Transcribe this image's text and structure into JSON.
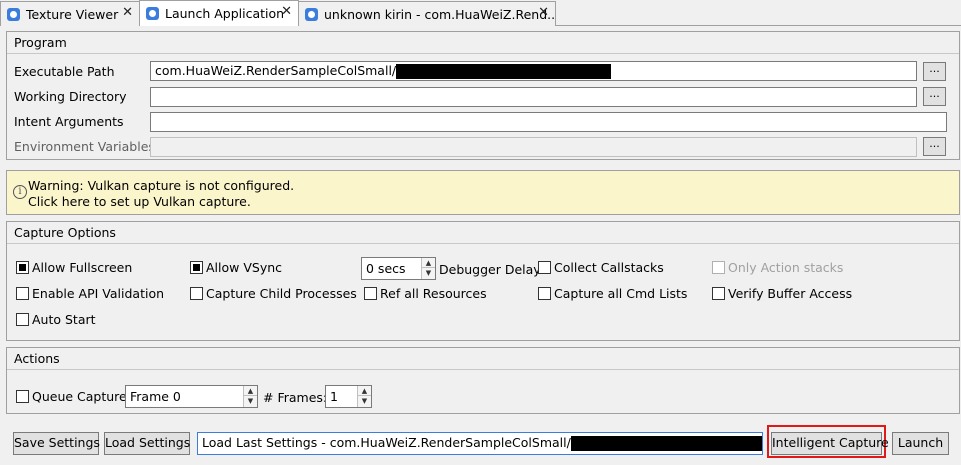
{
  "tabs": [
    {
      "label": "Texture Viewer",
      "close": "✕"
    },
    {
      "label": "Launch Application",
      "close": "✕"
    },
    {
      "label": "unknown kirin - com.HuaWeiZ.Rend...",
      "close": "✕"
    }
  ],
  "program": {
    "title": "Program",
    "executable_path_label": "Executable Path",
    "executable_path_value": "com.HuaWeiZ.RenderSampleColSmall/",
    "working_directory_label": "Working Directory",
    "working_directory_value": "",
    "intent_arguments_label": "Intent Arguments",
    "intent_arguments_value": "",
    "environment_variables_label": "Environment Variables",
    "environment_variables_value": "",
    "browse_label": "..."
  },
  "warning": {
    "icon": "info-icon",
    "line1": "Warning: Vulkan capture is not configured.",
    "line2": "Click here to set up Vulkan capture."
  },
  "capture_options": {
    "title": "Capture Options",
    "allow_fullscreen": "Allow Fullscreen",
    "allow_vsync": "Allow VSync",
    "debugger_delay_value": "0 secs",
    "debugger_delay_label": "Debugger Delay",
    "collect_callstacks": "Collect Callstacks",
    "only_action_stacks": "Only Action stacks",
    "enable_api_validation": "Enable API Validation",
    "capture_child_processes": "Capture Child Processes",
    "ref_all_resources": "Ref all Resources",
    "capture_all_cmd_lists": "Capture all Cmd Lists",
    "verify_buffer_access": "Verify Buffer Access",
    "auto_start": "Auto Start"
  },
  "actions": {
    "title": "Actions",
    "queue_capture": "Queue Capture",
    "frame_value": "Frame 0",
    "frames_label": "# Frames:",
    "frames_value": "1"
  },
  "bottom": {
    "save_settings": "Save Settings",
    "load_settings": "Load Settings",
    "load_last_settings": "Load Last Settings - com.HuaWeiZ.RenderSampleColSmall/",
    "intelligent_capture": "Intelligent Capture",
    "launch": "Launch"
  },
  "colors": {
    "highlight": "#e01818",
    "warning_bg": "#fbf5cc",
    "tab_icon": "#3b7ddd"
  }
}
